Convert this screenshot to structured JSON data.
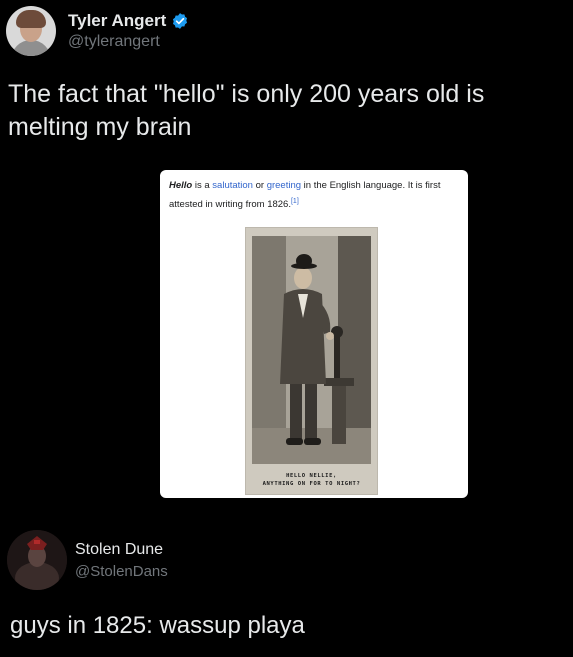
{
  "tweet": {
    "display_name": "Tyler Angert",
    "handle": "@tylerangert",
    "text": "The fact that \"hello\" is only 200 years old is melting my brain"
  },
  "embed": {
    "word": "Hello",
    "text_part1": " is a ",
    "link1": "salutation",
    "text_part2": " or ",
    "link2": "greeting",
    "text_part3": " in the English language. It is first attested in writing from 1826.",
    "footnote": "[1]",
    "photo_caption_line1": "HELLO NELLIE,",
    "photo_caption_line2": "ANYTHING ON FOR TO NIGHT?"
  },
  "reply": {
    "display_name": "Stolen Dune",
    "handle": "@StolenDans",
    "text": "guys in 1825: wassup playa"
  },
  "colors": {
    "background": "#000000",
    "text_primary": "#e7e9ea",
    "text_secondary": "#71767b",
    "verified": "#1d9bf0",
    "wiki_link": "#3366cc"
  },
  "icons": {
    "verified": "verified-badge-icon"
  }
}
